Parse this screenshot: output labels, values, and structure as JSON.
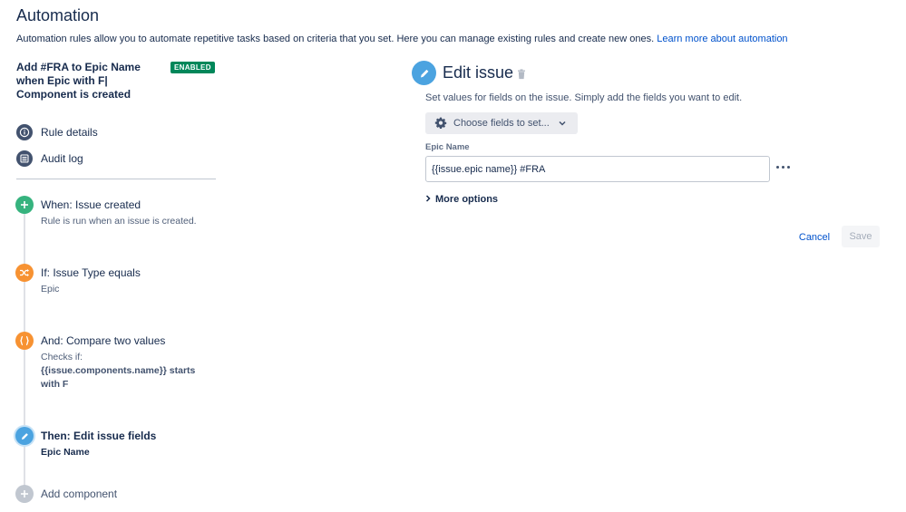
{
  "page": {
    "title": "Automation",
    "description": "Automation rules allow you to automate repetitive tasks based on criteria that you set. Here you can manage existing rules and create new ones.",
    "learn_more": "Learn more about automation"
  },
  "rule": {
    "name": "Add #FRA to Epic Name when Epic with F| Component is created",
    "status": "ENABLED"
  },
  "nav": {
    "rule_details": "Rule details",
    "audit_log": "Audit log"
  },
  "steps": {
    "when": {
      "title": "When: Issue created",
      "sub": "Rule is run when an issue is created.",
      "color": "#36b37e"
    },
    "if": {
      "title": "If: Issue Type equals",
      "sub": "Epic",
      "color": "#f79232"
    },
    "and": {
      "title": "And: Compare two values",
      "sub_prefix": "Checks if:",
      "sub_bold": "{{issue.components.name}} starts with F",
      "color": "#f79232"
    },
    "then": {
      "title": "Then: Edit issue fields",
      "sub": "Epic Name",
      "color": "#4ba3e0"
    },
    "add": {
      "title": "Add component",
      "color": "#c1c7d0"
    }
  },
  "edit": {
    "title": "Edit issue",
    "description": "Set values for fields on the issue. Simply add the fields you want to edit.",
    "choose_fields": "Choose fields to set...",
    "field_label": "Epic Name",
    "field_value": "{{issue.epic name}} #FRA",
    "more_options": "More options",
    "cancel": "Cancel",
    "save": "Save"
  },
  "colors": {
    "link": "#0052cc",
    "enabled_badge": "#00875a",
    "nav_icon": "#42526e"
  }
}
